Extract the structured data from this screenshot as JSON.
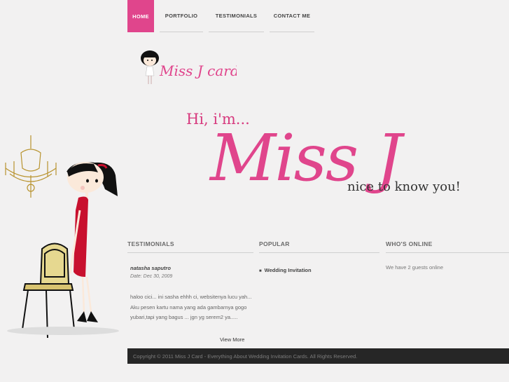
{
  "nav": {
    "items": [
      {
        "label": "HOME",
        "active": true
      },
      {
        "label": "PORTFOLIO",
        "active": false
      },
      {
        "label": "TESTIMONIALS",
        "active": false
      },
      {
        "label": "CONTACT ME",
        "active": false
      }
    ]
  },
  "logo": {
    "text": "Miss J card"
  },
  "hero": {
    "greeting": "Hi, i'm...",
    "name": "Miss J",
    "tagline": "nice to know you!"
  },
  "testimonials": {
    "heading": "TESTIMONIALS",
    "name": "natasha saputro",
    "date": "Date: Dec 30, 2009",
    "body": "haloo cici... ini sasha ehhh ci, websitenya lucu yah... Aku pesen kartu nama yang ada gambarnya gogo yubari,tapi yang bagus ... jgn yg serem2 ya.....",
    "view_more": "View More"
  },
  "popular": {
    "heading": "POPULAR",
    "items": [
      "Wedding Invitation"
    ]
  },
  "online": {
    "heading": "WHO'S ONLINE",
    "text": "We have 2 guests online"
  },
  "footer": {
    "text": "Copyright © 2011 Miss J Card - Everything About Wedding Invitation Cards. All Rights Reserved."
  },
  "colors": {
    "accent": "#e0458c",
    "footer_bg": "#262626",
    "dress": "#c8102e"
  }
}
